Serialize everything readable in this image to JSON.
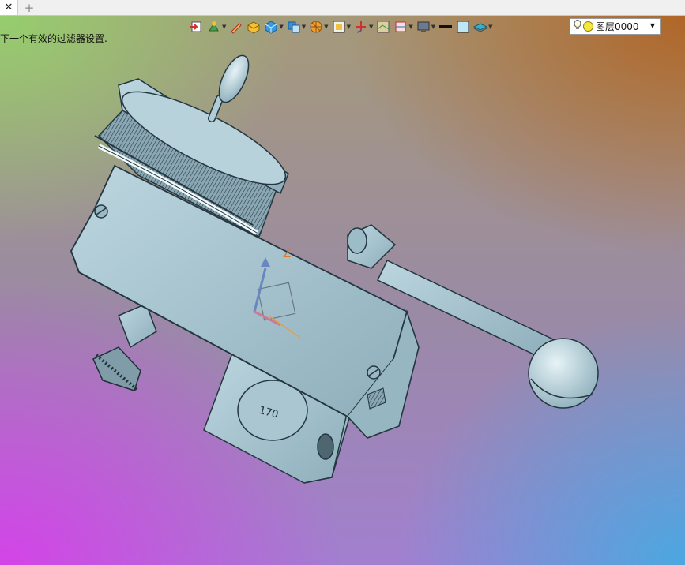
{
  "tabs": {
    "close_glyph": "✕",
    "add_glyph": "+"
  },
  "status": {
    "message": "下一个有效的过滤器设置."
  },
  "toolbar": {
    "items": [
      {
        "icon": "import-icon",
        "has_dropdown": false
      },
      {
        "icon": "tree-filter-icon",
        "has_dropdown": true
      },
      {
        "icon": "pen-icon",
        "has_dropdown": false
      },
      {
        "icon": "render-box-icon",
        "has_dropdown": false
      },
      {
        "icon": "view-cube-icon",
        "has_dropdown": true
      },
      {
        "icon": "display-style-icon",
        "has_dropdown": true
      },
      {
        "icon": "section-wheel-icon",
        "has_dropdown": true
      },
      {
        "icon": "frame-icon",
        "has_dropdown": true
      },
      {
        "icon": "axis-triad-icon",
        "has_dropdown": true
      },
      {
        "icon": "texture-icon",
        "has_dropdown": false
      },
      {
        "icon": "dimension-icon",
        "has_dropdown": true
      },
      {
        "icon": "monitor-icon",
        "has_dropdown": true
      },
      {
        "icon": "line-width-icon",
        "has_dropdown": false
      },
      {
        "icon": "color-swatch-icon",
        "has_dropdown": false
      },
      {
        "icon": "layer-stack-icon",
        "has_dropdown": true
      }
    ]
  },
  "layer": {
    "name": "图层0000"
  },
  "model": {
    "dial_label": "170",
    "axis_label": "Z",
    "colors": {
      "body": "#a6c4d0",
      "edge": "#243640",
      "axis_z": "#e07a2a"
    }
  }
}
